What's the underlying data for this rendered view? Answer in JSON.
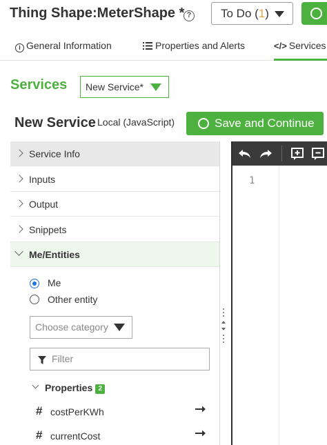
{
  "header": {
    "thing_title": "Thing Shape:MeterShape *",
    "help_icon": "?",
    "todo_label": "To Do (",
    "todo_count": "1",
    "todo_close": ")"
  },
  "tabs": [
    {
      "label": "General Information",
      "icon": "info-icon"
    },
    {
      "label": "Properties and Alerts",
      "icon": "list-icon"
    },
    {
      "label": "Services",
      "icon": "code-icon",
      "active": true
    }
  ],
  "services": {
    "title": "Services",
    "selected_service": "New Service*"
  },
  "editor_header": {
    "title": "New Service",
    "type": "Local (JavaScript)",
    "save_label": "Save and Continue"
  },
  "accordion": [
    {
      "label": "Service Info",
      "expanded": false
    },
    {
      "label": "Inputs",
      "expanded": false
    },
    {
      "label": "Output",
      "expanded": false
    },
    {
      "label": "Snippets",
      "expanded": false
    },
    {
      "label": "Me/Entities",
      "expanded": true
    }
  ],
  "me_entities": {
    "radio_me": "Me",
    "radio_other": "Other entity",
    "selected": "Me",
    "category_placeholder": "Choose category",
    "filter_placeholder": "Filter",
    "properties_label": "Properties",
    "properties_count": "2",
    "properties": [
      "costPerKWh",
      "currentCost"
    ]
  },
  "code_editor": {
    "line_numbers": [
      "1"
    ]
  },
  "colors": {
    "accent_green": "#4cb13f",
    "todo_count": "#e8a33d",
    "radio_blue": "#1a73e8",
    "toolbar_dark": "#3a3a3a"
  }
}
